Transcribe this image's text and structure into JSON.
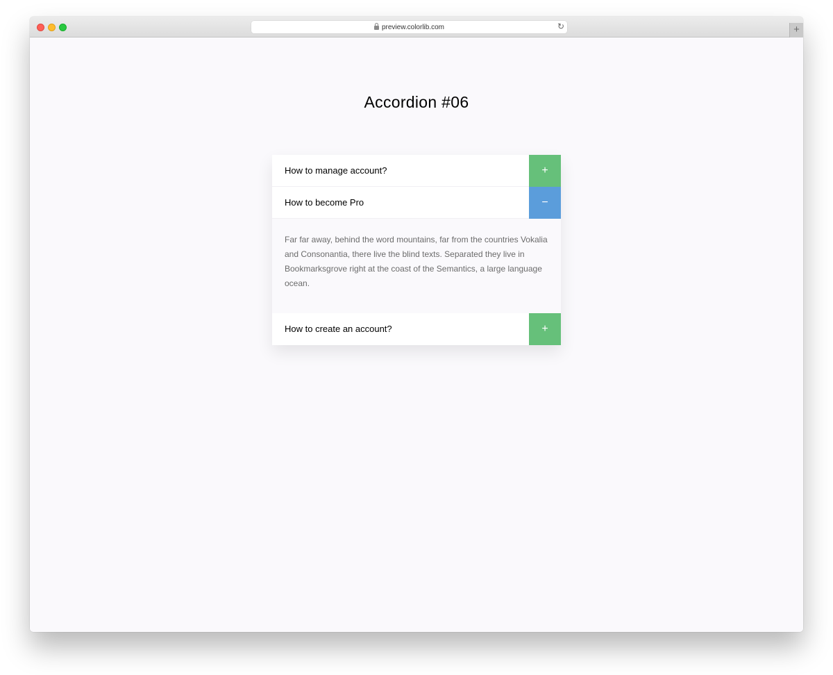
{
  "browser": {
    "url": "preview.colorlib.com",
    "newtab_label": "+",
    "reload_icon": "reload-icon"
  },
  "page": {
    "title": "Accordion #06"
  },
  "accordion": {
    "items": [
      {
        "question": "How to manage account?",
        "toggle": "+",
        "expanded": false,
        "color": "#66c07a"
      },
      {
        "question": "How to become Pro",
        "toggle": "−",
        "expanded": true,
        "color": "#5b9ddb",
        "answer": "Far far away, behind the word mountains, far from the countries Vokalia and Consonantia, there live the blind texts. Separated they live in Bookmarksgrove right at the coast of the Semantics, a large language ocean."
      },
      {
        "question": "How to create an account?",
        "toggle": "+",
        "expanded": false,
        "color": "#66c07a"
      }
    ]
  },
  "colors": {
    "plus_button": "#66c07a",
    "minus_button": "#5b9ddb",
    "page_background": "#faf9fc"
  }
}
